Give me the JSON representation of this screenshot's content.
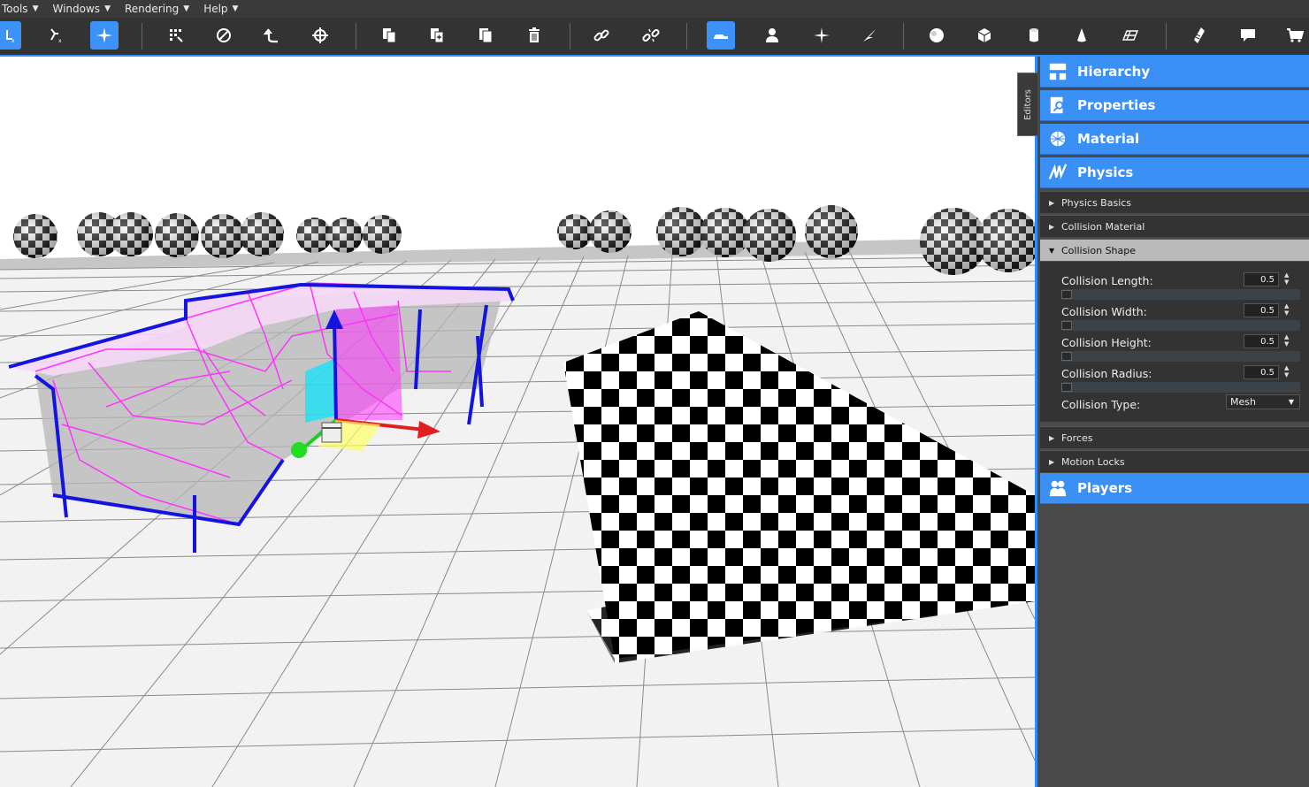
{
  "menu": [
    {
      "label": "Tools"
    },
    {
      "label": "Windows"
    },
    {
      "label": "Rendering"
    },
    {
      "label": "Help"
    }
  ],
  "toolbar": {
    "tools": [
      "move-local-icon",
      "move-axis-icon",
      "transform-icon",
      "grid-snap-icon",
      "disable-icon",
      "undo-icon",
      "crosshair-icon",
      "copy-icon",
      "paste-icon",
      "duplicate-icon",
      "delete-icon",
      "link-icon",
      "unlink-icon",
      "vehicle-icon",
      "character-icon",
      "light-icon",
      "particles-icon",
      "sphere-icon",
      "cube-icon",
      "cylinder-icon",
      "cone-icon",
      "plane-icon",
      "script-icon",
      "comment-icon",
      "shopping-cart-icon"
    ],
    "active": [
      "move-local-icon",
      "transform-icon",
      "vehicle-icon"
    ]
  },
  "editors_tab": "Editors",
  "panel": {
    "sections": {
      "hierarchy": "Hierarchy",
      "properties": "Properties",
      "material": "Material",
      "physics": "Physics",
      "players": "Players"
    },
    "physics_groups": {
      "basics": "Physics Basics",
      "collision_material": "Collision Material",
      "collision_shape": "Collision Shape",
      "forces": "Forces",
      "motion_locks": "Motion Locks"
    },
    "collision_shape": {
      "length_label": "Collision Length:",
      "length_value": "0.5",
      "width_label": "Collision Width:",
      "width_value": "0.5",
      "height_label": "Collision Height:",
      "height_value": "0.5",
      "radius_label": "Collision Radius:",
      "radius_value": "0.5",
      "type_label": "Collision Type:",
      "type_value": "Mesh"
    }
  },
  "colors": {
    "accent": "#3b90f6",
    "toolbar_bg": "#333333",
    "panel_bg": "#4a4a4a",
    "wireframe": "#ff33ff",
    "outline": "#1e1ee6"
  }
}
